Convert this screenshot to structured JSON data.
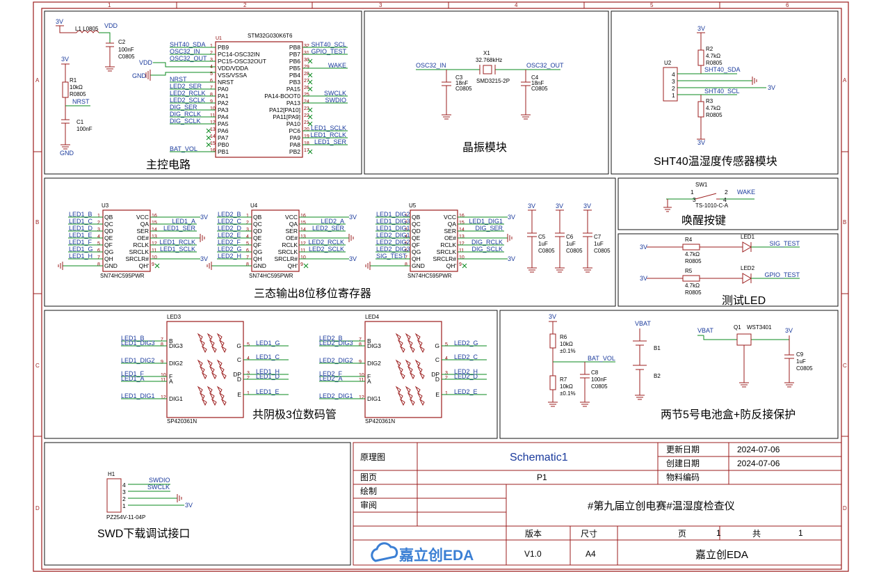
{
  "border": {
    "col_labels": [
      "1",
      "2",
      "3",
      "4",
      "5",
      "6"
    ],
    "row_labels": [
      "A",
      "B",
      "C",
      "D"
    ]
  },
  "colors": {
    "frame": "#9b1c1c",
    "wire": "#0a8a1e",
    "net": "#1a3a9c",
    "text": "#000000"
  },
  "modules": {
    "mcu": "主控电路",
    "crystal": "晶振模块",
    "sht40": "SHT40温湿度传感器模块",
    "shift": "三态输出8位移位寄存器",
    "wake": "唤醒按键",
    "testled": "测试LED",
    "digits": "共阴极3位数码管",
    "battery": "两节5号电池盒+防反接保护",
    "swd": "SWD下载调试接口"
  },
  "mcu": {
    "part": "STM32G030K6T6",
    "ref": "U1",
    "left_pins": [
      "PB9",
      "PC14-OSC32IN",
      "PC15-OSC32OUT",
      "VDD/VDDA",
      "VSS/VSSA",
      "NRST",
      "PA0",
      "PA1",
      "PA2",
      "PA3",
      "PA4",
      "PA5",
      "PA6",
      "PA7",
      "PB0",
      "PB1"
    ],
    "right_pins": [
      "PB8",
      "PB7",
      "PB6",
      "PB5",
      "PB4",
      "PB3",
      "PA15",
      "PA14-BOOT0",
      "PA13",
      "PA12[PA10]",
      "PA11[PA9]",
      "PA10",
      "PC6",
      "PA9",
      "PA8",
      "PB2"
    ],
    "left_nets": [
      "SHT40_SDA",
      "OSC32_IN",
      "OSC32_OUT",
      "VDD",
      "GND",
      "NRST",
      "LED2_SER",
      "LED2_RCLK",
      "LED2_SCLK",
      "DIG_SER",
      "DIG_RCLK",
      "DIG_SCLK",
      "",
      "",
      "",
      "BAT_VOL"
    ],
    "right_nets": [
      "SHT40_SCL",
      "GPIO_TEST",
      "",
      "WAKE",
      "",
      "",
      "",
      "SWCLK",
      "SWDIO",
      "",
      "",
      "",
      "LED1_SCLK",
      "LED1_RCLK",
      "LED1_SER",
      ""
    ],
    "l1": {
      "ref": "L1",
      "value": "L0805",
      "net": "VDD"
    },
    "c2": {
      "ref": "C2",
      "value": "100nF",
      "pkg": "C0805"
    },
    "r1": {
      "ref": "R1",
      "value": "10kΩ",
      "pkg": "R0805"
    },
    "c1": {
      "ref": "C1",
      "value": "100nF"
    },
    "v3": "3V",
    "gnd": "GND"
  },
  "crystal": {
    "ref": "X1",
    "freq": "32.768kHz",
    "pkg": "SMD3215-2P",
    "in": "OSC32_IN",
    "out": "OSC32_OUT",
    "c3": {
      "ref": "C3",
      "value": "18nF",
      "pkg": "C0805"
    },
    "c4": {
      "ref": "C4",
      "value": "18nF",
      "pkg": "C0805"
    }
  },
  "sht40": {
    "ref": "U2",
    "v3": "3V",
    "r2": {
      "ref": "R2",
      "value": "4.7kΩ",
      "pkg": "R0805"
    },
    "r3": {
      "ref": "R3",
      "value": "4.7kΩ",
      "pkg": "R0805"
    },
    "sda": "SHT40_SDA",
    "scl": "SHT40_SCL",
    "pins": [
      "4",
      "3",
      "2",
      "1"
    ]
  },
  "shift": {
    "chips": [
      {
        "ref": "U3",
        "part": "SN74HC595PWR",
        "in_nets": [
          "LED1_B",
          "LED1_C",
          "LED1_D",
          "LED1_E",
          "LED1_F",
          "LED1_G",
          "LED1_H"
        ],
        "out_nets": [
          "LED1_A",
          "LED1_SER",
          "LED1_RCLK",
          "LED1_SCLK"
        ]
      },
      {
        "ref": "U4",
        "part": "SN74HC595PWR",
        "in_nets": [
          "LED2_B",
          "LED2_C",
          "LED2_D",
          "LED2_E",
          "LED2_F",
          "LED2_G",
          "LED2_H"
        ],
        "out_nets": [
          "LED2_A",
          "LED2_SER",
          "LED2_RCLK",
          "LED2_SCLK"
        ]
      },
      {
        "ref": "U5",
        "part": "SN74HC595PWR",
        "in_nets": [
          "LED1_DIG2",
          "LED1_DIG3",
          "LED1_DIG1",
          "LED2_DIG1",
          "LED2_DIG2",
          "LED2_DIG3",
          "SIG_TEST"
        ],
        "out_nets": [
          "LED1_DIG1",
          "DIG_SER",
          "DIG_RCLK",
          "DIG_SCLK"
        ]
      }
    ],
    "left_pins": [
      "QB",
      "QC",
      "QD",
      "QE",
      "QF",
      "QG",
      "QH",
      "GND"
    ],
    "left_nums": [
      "1",
      "2",
      "3",
      "4",
      "5",
      "6",
      "7",
      "8"
    ],
    "right_pins": [
      "VCC",
      "QA",
      "SER",
      "OE#",
      "RCLK",
      "SRCLK",
      "SRCLR#",
      "QH'"
    ],
    "right_nums": [
      "16",
      "15",
      "14",
      "13",
      "12",
      "11",
      "10",
      "9"
    ],
    "caps": [
      {
        "ref": "C5",
        "value": "1uF",
        "pkg": "C0805"
      },
      {
        "ref": "C6",
        "value": "1uF",
        "pkg": "C0805"
      },
      {
        "ref": "C7",
        "value": "1uF",
        "pkg": "C0805"
      }
    ],
    "v3": "3V"
  },
  "wake": {
    "ref": "SW1",
    "part": "TS-1010-C-A",
    "net": "WAKE",
    "pins": [
      "1",
      "2",
      "3",
      "4"
    ]
  },
  "testled": {
    "rows": [
      {
        "v": "3V",
        "r": "R4",
        "val": "4.7kΩ",
        "pkg": "R0805",
        "led": "LED1",
        "net": "SIG_TEST"
      },
      {
        "v": "3V",
        "r": "R5",
        "val": "4.7kΩ",
        "pkg": "R0805",
        "led": "LED2",
        "net": "GPIO_TEST"
      }
    ]
  },
  "digits": {
    "displays": [
      {
        "ref": "LED3",
        "part": "SP420361N",
        "left_nets": [
          "LED1_B",
          "LED1_DIG3",
          "LED1_DIG2",
          "LED1_F",
          "LED1_A",
          "LED1_DIG1"
        ],
        "right_nets": [
          "LED1_G",
          "LED1_C",
          "LED1_H",
          "LED1_D",
          "LED1_E"
        ]
      },
      {
        "ref": "LED4",
        "part": "SP420361N",
        "left_nets": [
          "LED2_B",
          "LED2_DIG3",
          "LED2_DIG2",
          "LED2_F",
          "LED2_A",
          "LED2_DIG1"
        ],
        "right_nets": [
          "LED2_G",
          "LED2_C",
          "LED2_H",
          "LED2_D",
          "LED2_E"
        ]
      }
    ],
    "left_pins": [
      "B",
      "DIG3",
      "DIG2",
      "F",
      "A",
      "DIG1"
    ],
    "left_nums": [
      "7",
      "8",
      "9",
      "10",
      "11",
      "12"
    ],
    "right_pins": [
      "G",
      "C",
      "DP",
      "D",
      "E"
    ],
    "right_nums": [
      "5",
      "4",
      "3",
      "2",
      "1"
    ]
  },
  "battery": {
    "v3": "3V",
    "r6": {
      "ref": "R6",
      "value": "10kΩ",
      "tol": "±0.1%"
    },
    "r7": {
      "ref": "R7",
      "value": "10kΩ",
      "tol": "±0.1%"
    },
    "bat_vol": "BAT_VOL",
    "c8": {
      "ref": "C8",
      "value": "100nF",
      "pkg": "C0805"
    },
    "vbat": "VBAT",
    "b1": "B1",
    "b2": "B2",
    "q1": {
      "ref": "Q1",
      "part": "WST3401"
    },
    "c9": {
      "ref": "C9",
      "value": "1uF",
      "pkg": "C0805"
    }
  },
  "swd": {
    "ref": "H1",
    "part": "PZ254V-11-04P",
    "nets": [
      "SWDIO",
      "SWCLK",
      "3V"
    ],
    "pins": [
      "4",
      "3",
      "2",
      "1"
    ]
  },
  "titleblock": {
    "schematic_label": "原理图",
    "schematic_name": "Schematic1",
    "updated_label": "更新日期",
    "updated": "2024-07-06",
    "created_label": "创建日期",
    "created": "2024-07-06",
    "page_label": "图页",
    "page": "P1",
    "part_no_label": "物料编码",
    "drawn_label": "绘制",
    "review_label": "审阅",
    "project": "#第九届立创电赛#温湿度检查仪",
    "version_label": "版本",
    "size_label": "尺寸",
    "pg_label": "页",
    "pg_num": "1",
    "total_label": "共",
    "total_num": "1",
    "version": "V1.0",
    "size": "A4",
    "company": "嘉立创EDA",
    "logo": "嘉立创EDA"
  }
}
